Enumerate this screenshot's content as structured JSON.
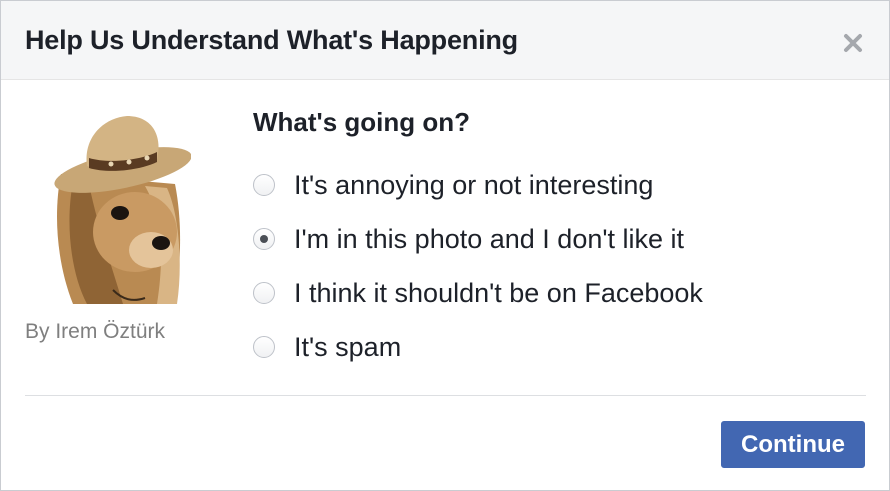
{
  "dialog": {
    "title": "Help Us Understand What's Happening",
    "close_icon": "close-icon"
  },
  "sidebar": {
    "photo_subject": "dog-in-cowboy-hat-photo",
    "credit": "By Irem Öztürk"
  },
  "form": {
    "question": "What's going on?",
    "options": [
      {
        "label": "It's annoying or not interesting",
        "checked": false
      },
      {
        "label": "I'm in this photo and I don't like it",
        "checked": true
      },
      {
        "label": "I think it shouldn't be on Facebook",
        "checked": false
      },
      {
        "label": "It's spam",
        "checked": false
      }
    ]
  },
  "footer": {
    "continue_label": "Continue"
  },
  "colors": {
    "primary_button": "#4267b2",
    "header_bg": "#f5f6f7",
    "text": "#1d2129",
    "muted_text": "#7f7f7f"
  }
}
